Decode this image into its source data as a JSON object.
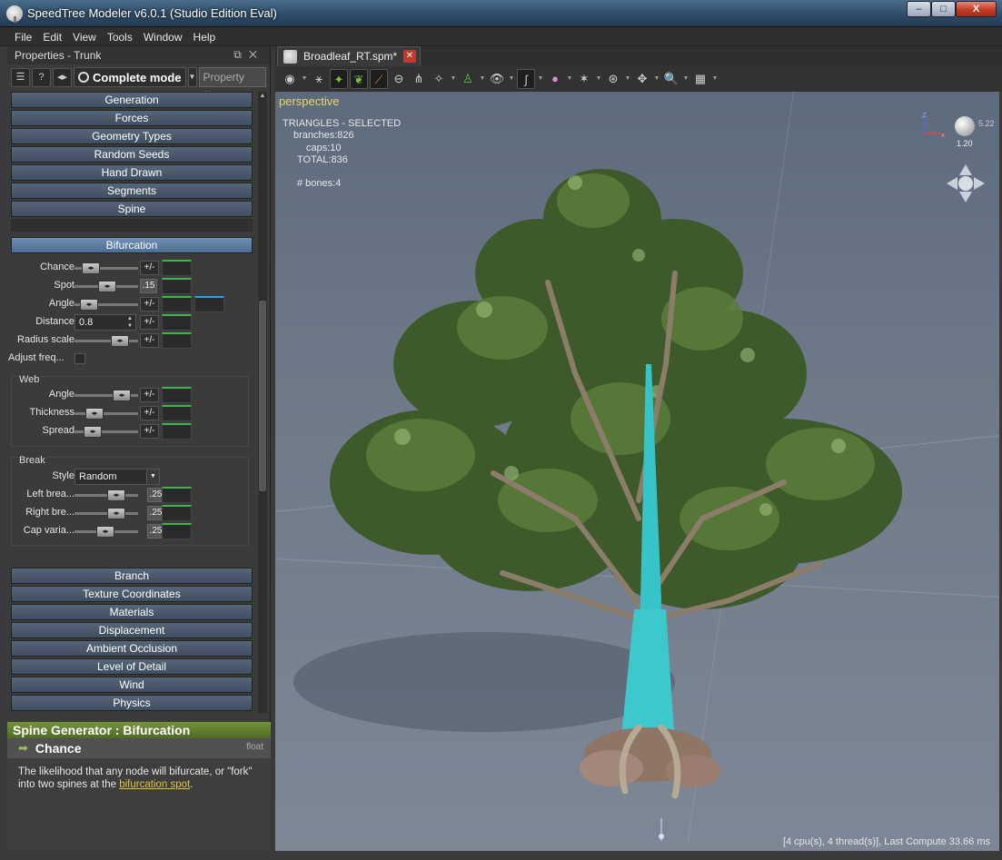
{
  "window": {
    "title": "SpeedTree Modeler v6.0.1 (Studio Edition Eval)",
    "buttons": [
      "–",
      "□",
      "X"
    ]
  },
  "menubar": [
    "File",
    "Edit",
    "View",
    "Tools",
    "Window",
    "Help"
  ],
  "properties_panel": {
    "title": "Properties - Trunk",
    "mode_label": "Complete mode",
    "filter_placeholder": "Property filter",
    "sections_top": [
      "Generation",
      "Forces",
      "Geometry Types",
      "Random Seeds",
      "Hand Drawn",
      "Segments",
      "Spine"
    ],
    "active_section": "Bifurcation",
    "rows": {
      "chance": "Chance",
      "spot": "Spot",
      "spot_value": ".15",
      "angle": "Angle",
      "distance": "Distance",
      "distance_value": "0.8",
      "radius_scale": "Radius scale",
      "adjust_freq": "Adjust freq...",
      "pm": "+/-"
    },
    "web": {
      "title": "Web",
      "angle": "Angle",
      "thickness": "Thickness",
      "spread": "Spread"
    },
    "break": {
      "title": "Break",
      "style": "Style",
      "style_value": "Random",
      "left": "Left brea...",
      "left_value": ".25",
      "right": "Right bre...",
      "right_value": ".25",
      "cap": "Cap varia...",
      "cap_value": ".25"
    },
    "sections_bottom": [
      "Branch",
      "Texture Coordinates",
      "Materials",
      "Displacement",
      "Ambient Occlusion",
      "Level of Detail",
      "Wind",
      "Physics"
    ]
  },
  "help": {
    "header": "Spine Generator : Bifurcation",
    "property": "Chance",
    "type": "float",
    "text_before": "The likelihood that any node will bifurcate, or \"fork\" into two spines at the ",
    "link": "bifurcation spot",
    "text_after": "."
  },
  "document_tab": "Broadleaf_RT.spm*",
  "viewport": {
    "mode": "perspective",
    "stats": {
      "header": "TRIANGLES - SELECTED",
      "branches": "branches:826",
      "caps": "caps:10",
      "total": "TOTAL:836",
      "bones": "# bones:4"
    },
    "zoom_value": "1.20",
    "zoom_side": "5.22",
    "axis_z": "Z",
    "axis_x": "x",
    "compute": "[4 cpu(s), 4 thread(s)], Last Compute 33.66 ms"
  },
  "colors": {
    "accent_green": "#3fb54b",
    "accent_blue": "#2e9fd8",
    "section_active": "#5b7ea6",
    "perspective_label": "#e8d76a",
    "help_header": "#5f7d2e",
    "trunk_selected": "#36c4c8"
  }
}
